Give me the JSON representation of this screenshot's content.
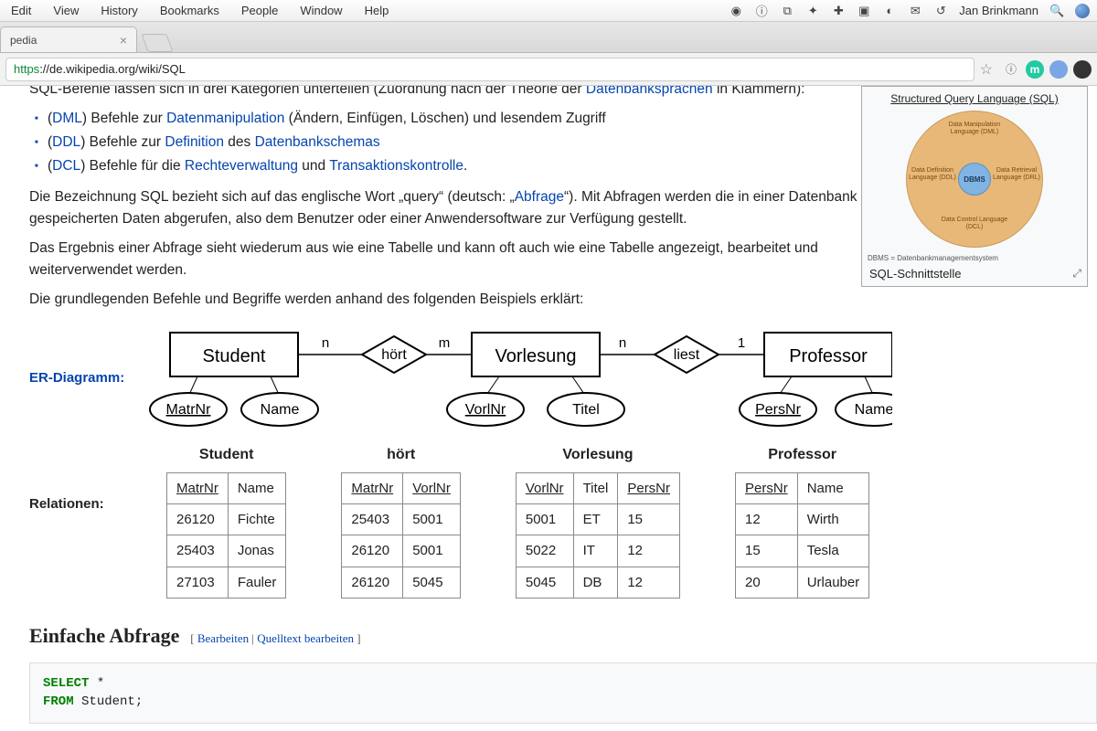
{
  "menubar": {
    "items": [
      "Edit",
      "View",
      "History",
      "Bookmarks",
      "People",
      "Window",
      "Help"
    ],
    "username": "Jan Brinkmann"
  },
  "tab": {
    "title": "pedia"
  },
  "url": {
    "scheme": "https",
    "rest": "://de.wikipedia.org/wiki/SQL"
  },
  "infobox": {
    "title": "Structured Query Language (SQL)",
    "center": "DBMS",
    "labels": {
      "top": "Data Manipulation\nLanguage (DML)",
      "left": "Data Definition\nLanguage (DDL)",
      "right": "Data Retrieval\nLanguage (DRL)",
      "bottom": "Data Control\nLanguage (DCL)"
    },
    "footnote": "DBMS =\nDatenbankmanagementsystem",
    "caption": "SQL-Schnittstelle"
  },
  "article": {
    "truncated_top": "SQL-Befehle lassen sich in drei Kategorien unterteilen (Zuordnung nach der Theorie der ",
    "truncated_top_link": "Datenbanksprachen",
    "truncated_top_after": " in Klammern):",
    "bullets": [
      {
        "pre": "(",
        "abbr": "DML",
        "post": ") Befehle zur ",
        "link": "Datenmanipulation",
        "after": " (Ändern, Einfügen, Löschen) und lesendem Zugriff"
      },
      {
        "pre": "(",
        "abbr": "DDL",
        "post": ") Befehle zur ",
        "link": "Definition",
        "after": " des ",
        "link2": "Datenbankschemas"
      },
      {
        "pre": "(",
        "abbr": "DCL",
        "post": ") Befehle für die ",
        "link": "Rechteverwaltung",
        "after": " und ",
        "link2": "Transaktionskontrolle",
        "tail": "."
      }
    ],
    "para1a": "Die Bezeichnung SQL bezieht sich auf das englische Wort „query“ (deutsch: „",
    "para1_link": "Abfrage",
    "para1b": "“). Mit Abfragen werden die in einer Datenbank gespeicherten Daten abgerufen, also dem Benutzer oder einer Anwendersoftware zur Verfügung gestellt.",
    "para2": "Das Ergebnis einer Abfrage sieht wiederum aus wie eine Tabelle und kann oft auch wie eine Tabelle angezeigt, bearbeitet und weiterverwendet werden.",
    "para3": "Die grundlegenden Befehle und Begriffe werden anhand des folgenden Beispiels erklärt:"
  },
  "er": {
    "label": "ER-Diagramm:",
    "entities": [
      "Student",
      "Vorlesung",
      "Professor"
    ],
    "rels": [
      "hört",
      "liest"
    ],
    "cards": [
      "n",
      "m",
      "n",
      "1"
    ],
    "attrs": {
      "student": [
        "MatrNr",
        "Name"
      ],
      "vorlesung": [
        "VorlNr",
        "Titel"
      ],
      "professor": [
        "PersNr",
        "Name"
      ]
    }
  },
  "relationen": {
    "label": "Relationen:",
    "tables": [
      {
        "title": "Student",
        "cols": [
          {
            "h": "MatrNr",
            "u": true
          },
          {
            "h": "Name"
          }
        ],
        "rows": [
          [
            "26120",
            "Fichte"
          ],
          [
            "25403",
            "Jonas"
          ],
          [
            "27103",
            "Fauler"
          ]
        ]
      },
      {
        "title": "hört",
        "cols": [
          {
            "h": "MatrNr",
            "u": true
          },
          {
            "h": "VorlNr",
            "u": true
          }
        ],
        "rows": [
          [
            "25403",
            "5001"
          ],
          [
            "26120",
            "5001"
          ],
          [
            "26120",
            "5045"
          ]
        ]
      },
      {
        "title": "Vorlesung",
        "cols": [
          {
            "h": "VorlNr",
            "u": true
          },
          {
            "h": "Titel"
          },
          {
            "h": "PersNr",
            "u": true
          }
        ],
        "rows": [
          [
            "5001",
            "ET",
            "15"
          ],
          [
            "5022",
            "IT",
            "12"
          ],
          [
            "5045",
            "DB",
            "12"
          ]
        ]
      },
      {
        "title": "Professor",
        "cols": [
          {
            "h": "PersNr",
            "u": true
          },
          {
            "h": "Name"
          }
        ],
        "rows": [
          [
            "12",
            "Wirth"
          ],
          [
            "15",
            "Tesla"
          ],
          [
            "20",
            "Urlauber"
          ]
        ]
      }
    ]
  },
  "section": {
    "heading": "Einfache Abfrage",
    "edit": "Bearbeiten",
    "editsrc": "Quelltext bearbeiten"
  },
  "code": {
    "select": "SELECT",
    "star": " *",
    "from": "FROM",
    "rest": " Student;"
  }
}
